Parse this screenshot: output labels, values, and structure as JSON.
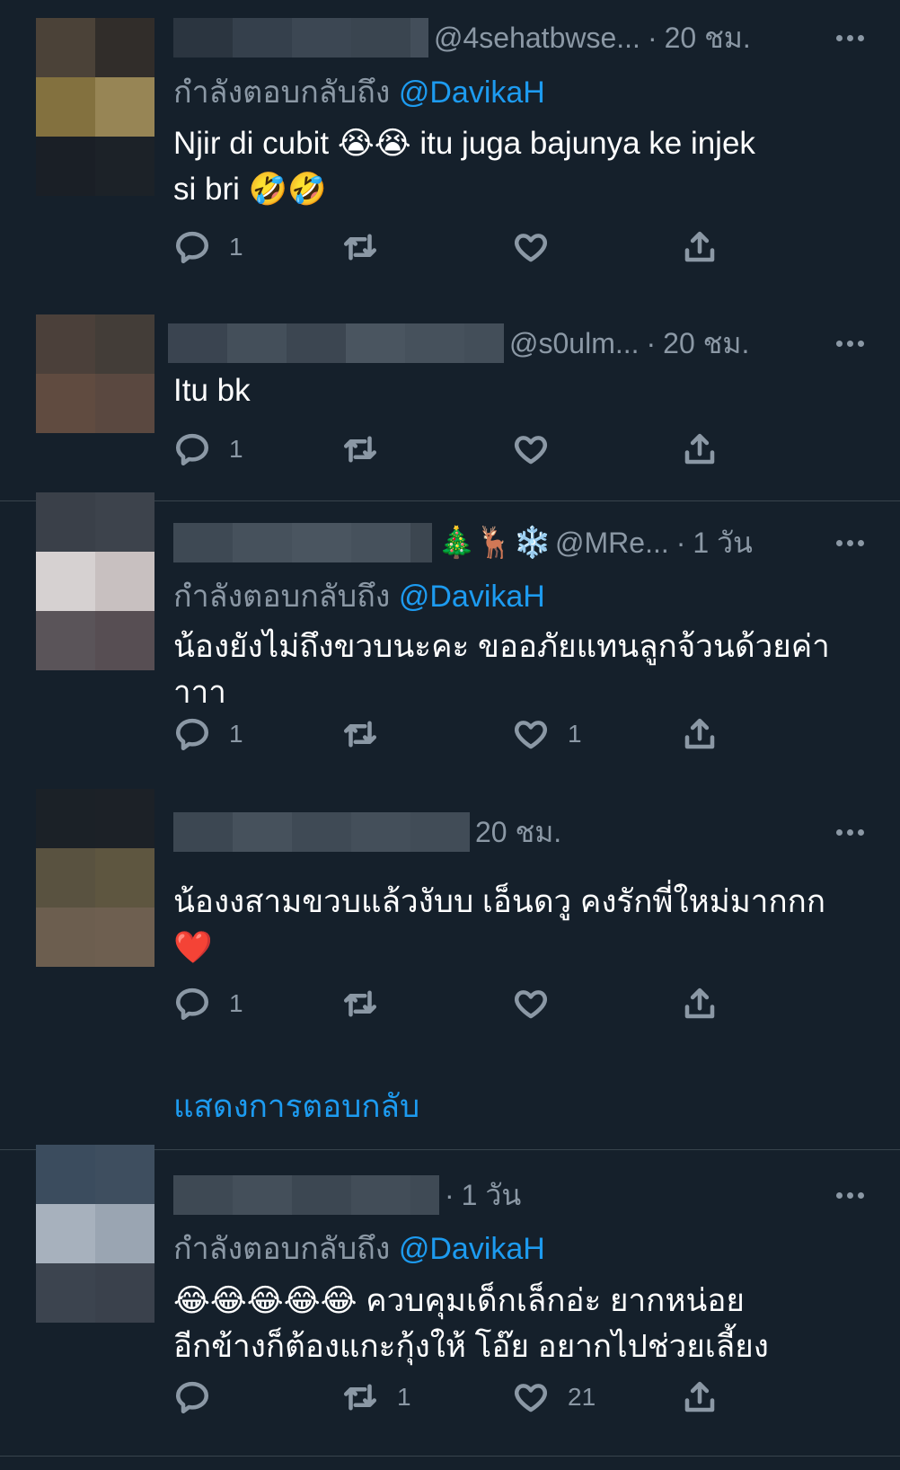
{
  "colors": {
    "background": "#15202b",
    "text": "#ffffff",
    "secondary": "#8b98a5",
    "accent": "#1d9bf0",
    "divider": "#38444d"
  },
  "tweets": [
    {
      "handle": "@4sehatbwse...",
      "time": "20 ชม.",
      "replying_prefix": "กำลังตอบกลับถึง",
      "replying_to": "@DavikaH",
      "text_lines": [
        "Njir di cubit 😭😭 itu juga bajunya ke injek",
        "si bri 🤣🤣"
      ],
      "replies": "1",
      "retweets": "",
      "likes": ""
    },
    {
      "handle": "@s0ulm...",
      "time": "20 ชม.",
      "text_lines": [
        "Itu bk"
      ],
      "replies": "1",
      "retweets": "",
      "likes": ""
    },
    {
      "name_emoji": "🎄🦌❄️",
      "handle": "@MRe...",
      "time": "1 วัน",
      "replying_prefix": "กำลังตอบกลับถึง",
      "replying_to": "@DavikaH",
      "text_lines": [
        "น้องยังไม่ถึงขวบนะคะ ขออภัยแทนลูกจ้วนด้วยค่า",
        "าาา"
      ],
      "replies": "1",
      "retweets": "",
      "likes": "1"
    },
    {
      "time": "20 ชม.",
      "text_lines": [
        "น้องงสามขวบแล้วงับบ เอ็นดวู คงรักพี่ใหม่มากกก",
        "❤️"
      ],
      "replies": "1",
      "retweets": "",
      "likes": ""
    },
    {
      "time": "1 วัน",
      "replying_prefix": "กำลังตอบกลับถึง",
      "replying_to": "@DavikaH",
      "text_lines": [
        "😂😂😂😂😂 ควบคุมเด็กเล็กอ่ะ ยากหน่อย",
        "อีกข้างก็ต้องแกะกุ้งให้ โอ๊ย อยากไปช่วยเลี้ยง"
      ],
      "replies": "",
      "retweets": "1",
      "likes": "21"
    }
  ],
  "show_replies": "แสดงการตอบกลับ",
  "icons": {
    "reply": "reply-icon",
    "retweet": "retweet-icon",
    "like": "heart-icon",
    "share": "share-icon",
    "more": "more-icon"
  }
}
